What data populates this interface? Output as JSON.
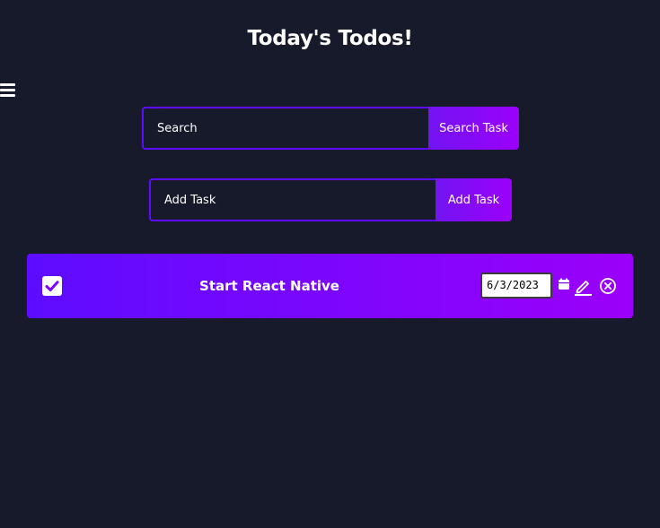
{
  "header": {
    "title": "Today's Todos!"
  },
  "menu": {
    "icon": "menu-icon"
  },
  "search": {
    "placeholder": "Search",
    "value": "",
    "button_label": "Search Task"
  },
  "add_task": {
    "placeholder": "Add Task",
    "value": "",
    "button_label": "Add Task"
  },
  "todos": [
    {
      "text": "Start React Native",
      "completed": true,
      "date": "6/3/2023",
      "icons": [
        "calendar-icon",
        "edit-icon",
        "delete-icon"
      ]
    }
  ],
  "colors": {
    "background": "#161a2b",
    "accent_start": "#5d0cff",
    "accent_end": "#9b00fa",
    "text": "#ffffff"
  }
}
